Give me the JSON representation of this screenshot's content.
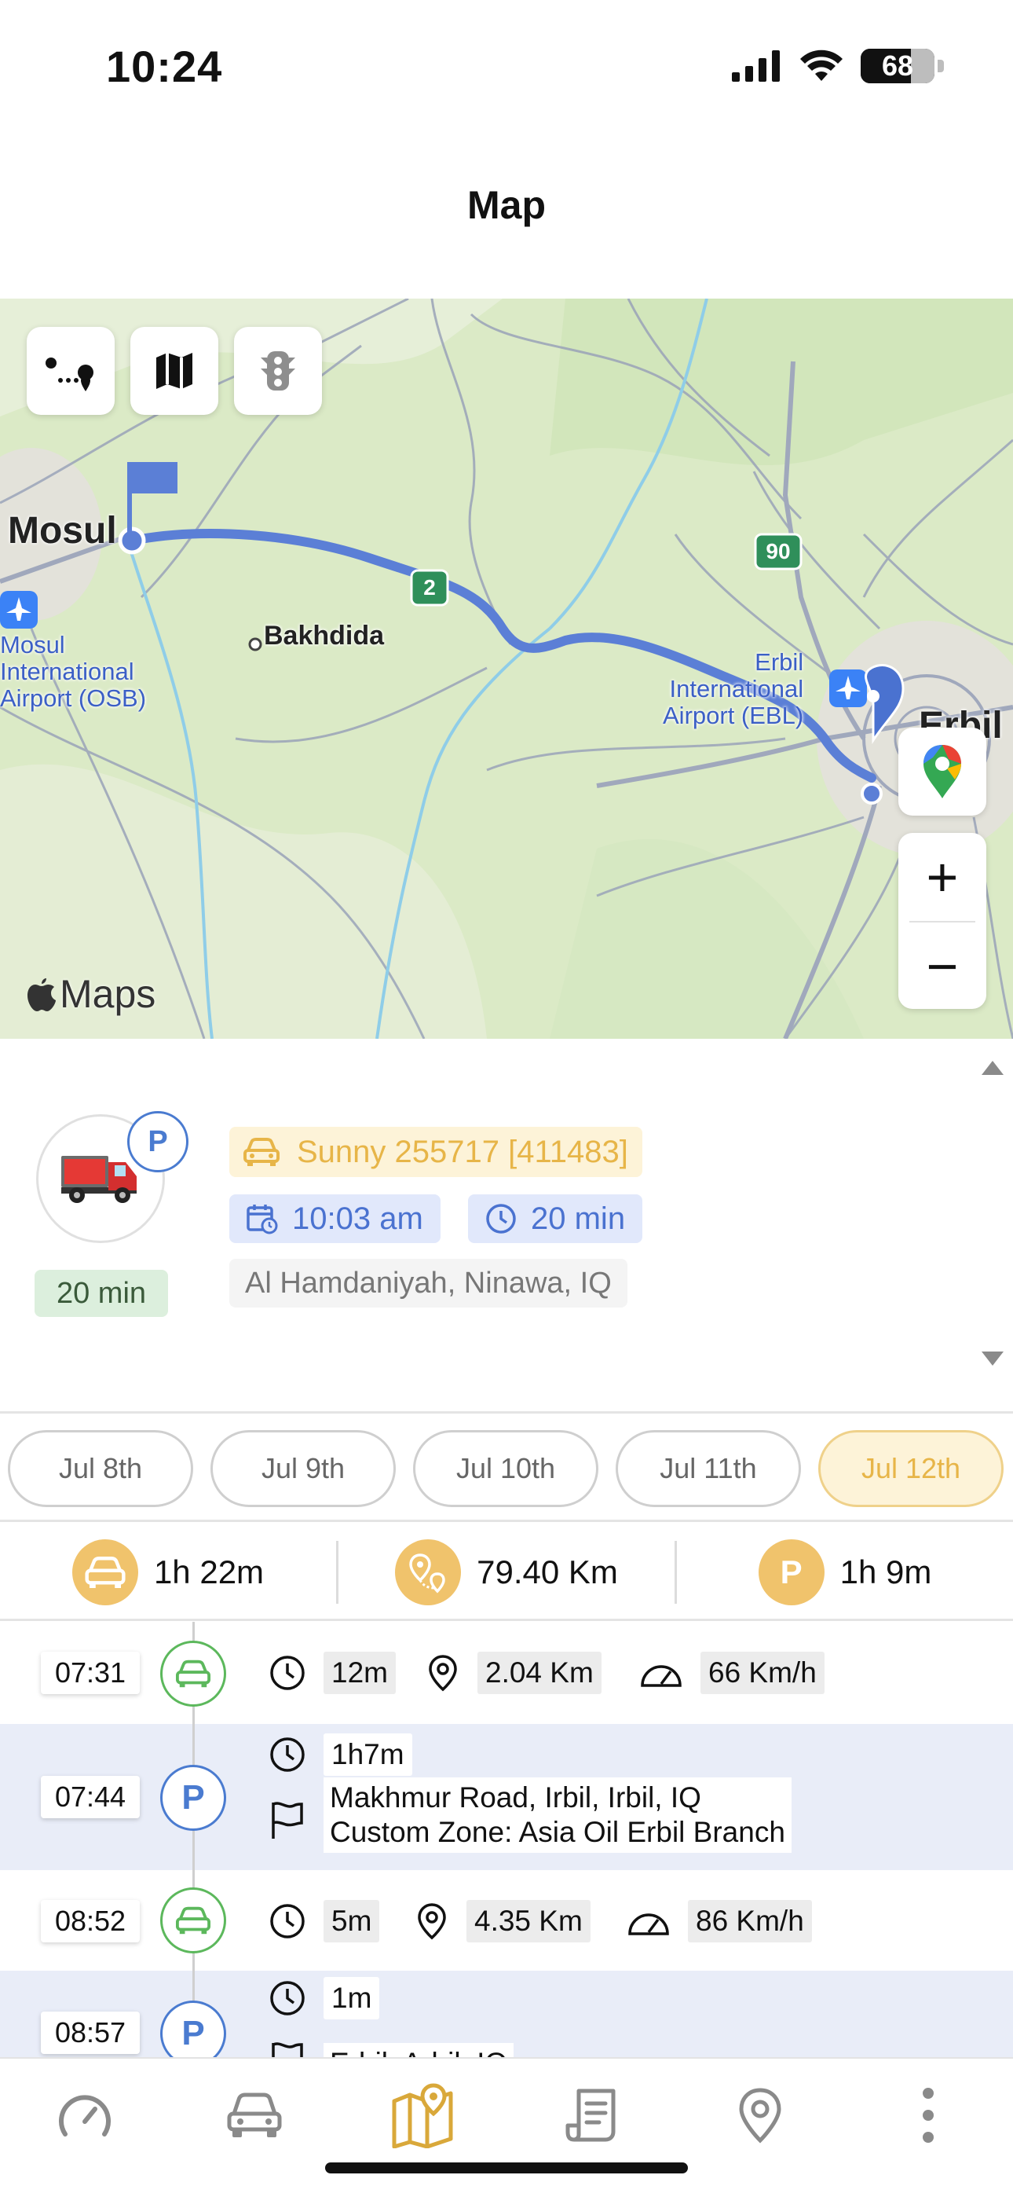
{
  "status_bar": {
    "time": "10:24",
    "battery": "68"
  },
  "header": {
    "title": "Map"
  },
  "map": {
    "labels": {
      "mosul": "Mosul",
      "bakhdida": "Bakhdida",
      "erbil": "Erbil",
      "mosul_airport": [
        "Mosul",
        "International",
        "Airport (OSB)"
      ],
      "erbil_airport": [
        "Erbil",
        "International",
        "Airport (EBL)"
      ],
      "road_2": "2",
      "road_90": "90"
    },
    "attribution": "Maps",
    "zoom_in": "+",
    "zoom_out": "−"
  },
  "vehicle": {
    "badge": "P",
    "duration": "20 min",
    "name": "Sunny 255717 [411483]",
    "start_time": "10:03 am",
    "elapsed": "20 min",
    "address": "Al Hamdaniyah, Ninawa, IQ"
  },
  "dates": [
    {
      "label": "Jul 8th",
      "active": false
    },
    {
      "label": "Jul 9th",
      "active": false
    },
    {
      "label": "Jul 10th",
      "active": false
    },
    {
      "label": "Jul 11th",
      "active": false
    },
    {
      "label": "Jul 12th",
      "active": true
    }
  ],
  "summary": {
    "drive_time": "1h 22m",
    "distance": "79.40 Km",
    "park_badge": "P",
    "park_time": "1h 9m"
  },
  "timeline": [
    {
      "time": "07:31",
      "type": "drive",
      "duration": "12m",
      "distance": "2.04 Km",
      "speed": "66 Km/h"
    },
    {
      "time": "07:44",
      "type": "park",
      "badge": "P",
      "duration": "1h7m",
      "address_line1": "Makhmur Road, Irbil, Irbil, IQ",
      "address_line2": "Custom Zone: Asia Oil Erbil Branch"
    },
    {
      "time": "08:52",
      "type": "drive",
      "duration": "5m",
      "distance": "4.35 Km",
      "speed": "86 Km/h"
    },
    {
      "time": "08:57",
      "type": "park",
      "badge": "P",
      "duration": "1m",
      "address_line1": "Erbil, Arbil, IQ"
    }
  ],
  "colors": {
    "accent_gold": "#E7B548",
    "accent_blue": "#4A72D0",
    "drive_green": "#5CB85C",
    "route_blue": "#5B7FD6"
  }
}
